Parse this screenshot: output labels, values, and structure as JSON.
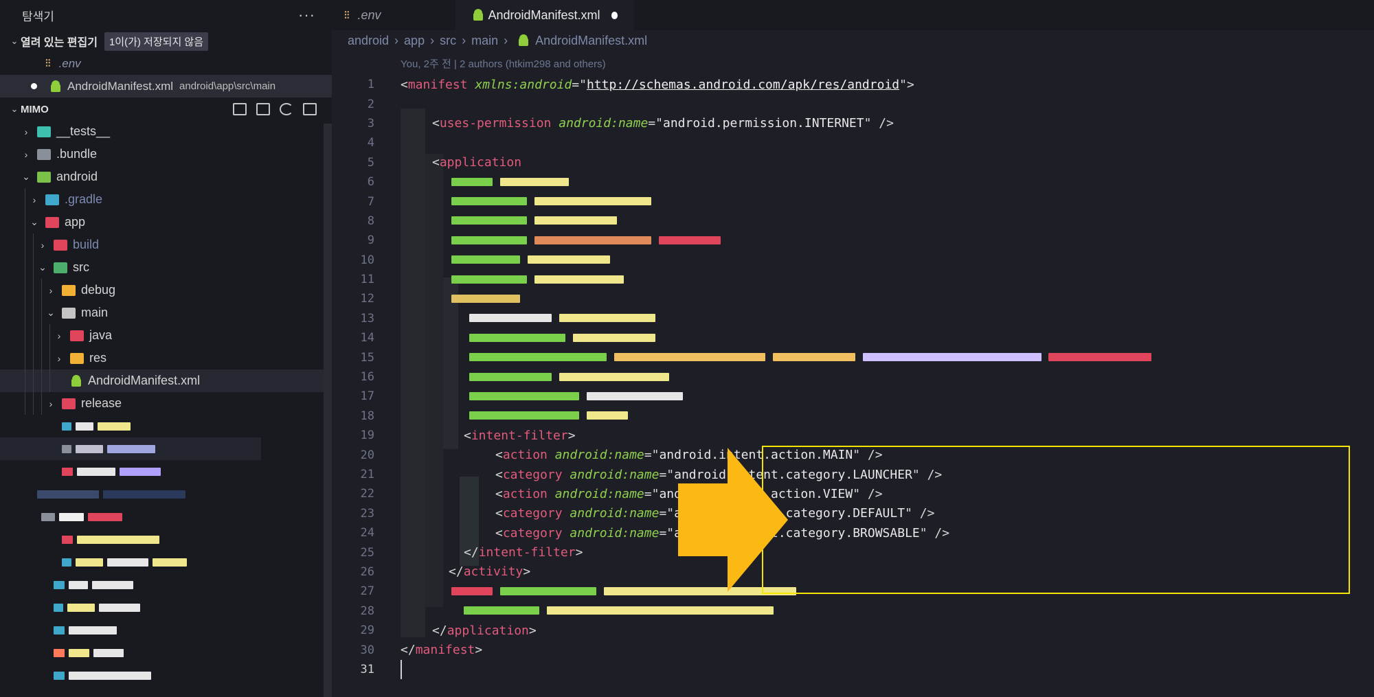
{
  "sidebar": {
    "title": "탐색기",
    "more_label": "···",
    "open_editors": {
      "label": "열려 있는 편집기",
      "badge": "1이(가) 저장되지 않음",
      "items": [
        {
          "name": ".env",
          "path": ""
        },
        {
          "name": "AndroidManifest.xml",
          "path": "android\\app\\src\\main"
        }
      ]
    },
    "project": {
      "label": "MIMO",
      "tree": [
        {
          "label": "__tests__",
          "color": "#3fbfae"
        },
        {
          "label": ".bundle",
          "color": "#8a8f99"
        },
        {
          "label": "android",
          "color": "#7cc24a"
        },
        {
          "label": ".gradle",
          "color": "#3fa7c9"
        },
        {
          "label": "app",
          "color": "#e0455b"
        },
        {
          "label": "build",
          "color": "#e0455b"
        },
        {
          "label": "src",
          "color": "#4cae6a"
        },
        {
          "label": "debug",
          "color": "#f2b134"
        },
        {
          "label": "main",
          "color": "#c5c5c5"
        },
        {
          "label": "java",
          "color": "#e0455b"
        },
        {
          "label": "res",
          "color": "#f2b134"
        },
        {
          "label": "AndroidManifest.xml",
          "color": "#8fce3a"
        },
        {
          "label": "release",
          "color": "#e0455b"
        }
      ]
    }
  },
  "tabs": [
    {
      "label": ".env",
      "icon": "env-icon"
    },
    {
      "label": "AndroidManifest.xml",
      "icon": "android-icon"
    }
  ],
  "breadcrumb": [
    "android",
    "app",
    "src",
    "main",
    "AndroidManifest.xml"
  ],
  "blame": "You, 2주 전 | 2 authors (htkim298 and others)",
  "code": {
    "line_numbers": [
      "1",
      "2",
      "3",
      "4",
      "5",
      "6",
      "7",
      "8",
      "9",
      "10",
      "11",
      "12",
      "13",
      "14",
      "15",
      "16",
      "17",
      "18",
      "19",
      "20",
      "21",
      "22",
      "23",
      "24",
      "25",
      "26",
      "27",
      "28",
      "29",
      "30",
      "31"
    ],
    "l1_tag": "manifest",
    "l1_attr": "xmlns:android",
    "l1_url": "http://schemas.android.com/apk/res/android",
    "l3_tag": "uses-permission",
    "l3_attr": "android:name",
    "l3_val": "android.permission.INTERNET",
    "l5_tag": "application",
    "l19_tag": "intent-filter",
    "l20_tag": "action",
    "l20_val": "android.intent.action.MAIN",
    "l21_tag": "category",
    "l21_val": "android.intent.category.LAUNCHER",
    "l22_tag": "action",
    "l22_val": "android.intent.action.VIEW",
    "l23_tag": "category",
    "l23_val": "android.intent.category.DEFAULT",
    "l24_tag": "category",
    "l24_val": "android.intent.category.BROWSABLE",
    "l25_tag": "intent-filter",
    "l26_tag": "activity",
    "l29_tag": "application",
    "l30_tag": "manifest",
    "name_attr": "android:name"
  }
}
